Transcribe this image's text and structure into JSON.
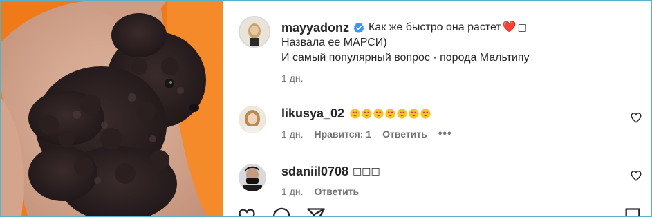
{
  "post": {
    "owner": {
      "username": "mayyadonz",
      "caption_line1": "Как же быстро она растет",
      "caption_line1_tail": "❤️",
      "caption_box": "□",
      "caption_line2": "Назвала ее МАРСИ)",
      "caption_line3": "И самый популярный вопрос - порода Мальтипу",
      "time": "1 дн."
    },
    "comments": [
      {
        "username": "likusya_02",
        "emoji_count": 7,
        "time": "1 дн.",
        "likes": "Нравится: 1",
        "reply": "Ответить",
        "more": "•••"
      },
      {
        "username": "sdaniil0708",
        "text": "□□□",
        "time": "1 дн.",
        "reply": "Ответить"
      }
    ]
  },
  "colors": {
    "photo_bg": "#f07a1a",
    "verified": "#3897f0",
    "heart": "#d1243f",
    "meta_text": "#737373",
    "frame_border": "#5ab0c8"
  },
  "icons": [
    "verified-badge-icon",
    "heart-icon",
    "like-heart-icon",
    "comment-icon",
    "share-icon",
    "bookmark-icon"
  ]
}
